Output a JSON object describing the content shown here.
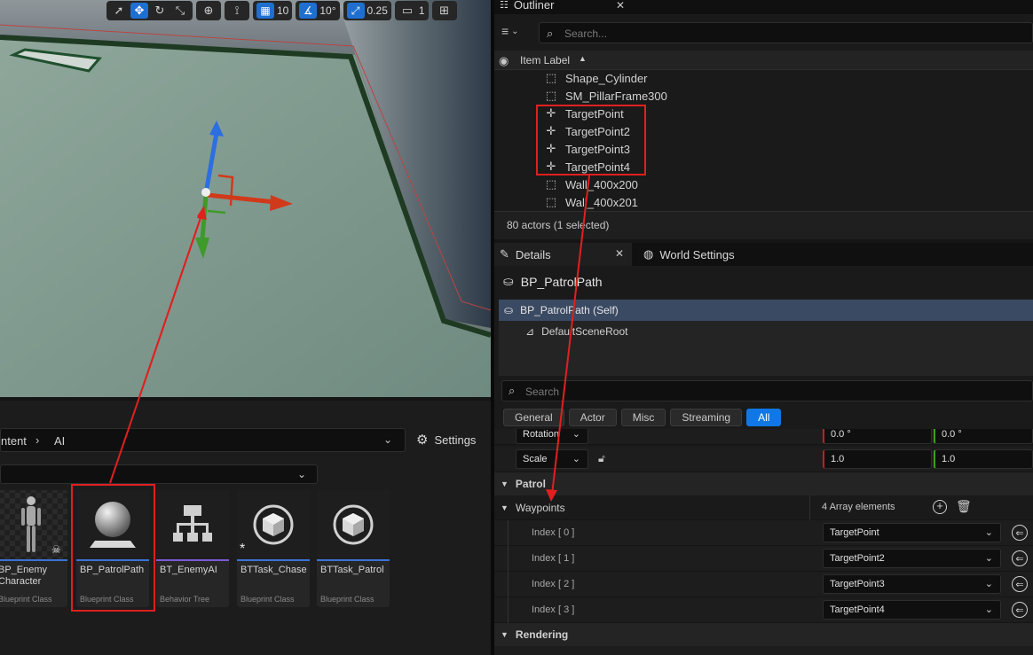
{
  "viewport": {
    "grid_size": "10",
    "rotation_snap": "10°",
    "scale_snap": "0.25",
    "camera_speed": "1"
  },
  "outliner": {
    "tab_label": "Outliner",
    "search_placeholder": "Search...",
    "column_header": "Item Label",
    "items": [
      {
        "label": "Shape_Cylinder",
        "icon": "mesh-icon"
      },
      {
        "label": "SM_PillarFrame300",
        "icon": "mesh-icon"
      },
      {
        "label": "TargetPoint",
        "icon": "target-point-icon"
      },
      {
        "label": "TargetPoint2",
        "icon": "target-point-icon"
      },
      {
        "label": "TargetPoint3",
        "icon": "target-point-icon"
      },
      {
        "label": "TargetPoint4",
        "icon": "target-point-icon"
      },
      {
        "label": "Wall_400x200",
        "icon": "mesh-icon"
      },
      {
        "label": "Wall_400x201",
        "icon": "mesh-icon"
      }
    ],
    "status": "80 actors (1 selected)"
  },
  "details": {
    "tab_label": "Details",
    "world_settings_tab": "World Settings",
    "actor_name": "BP_PatrolPath",
    "components": [
      {
        "label": "BP_PatrolPath (Self)"
      },
      {
        "label": "DefaultSceneRoot"
      }
    ],
    "search_placeholder": "Search",
    "filters": [
      "General",
      "Actor",
      "Misc",
      "Streaming",
      "All"
    ],
    "rotation_label": "Rotation",
    "rotation_x": "0.0 °",
    "rotation_y": "0.0 °",
    "scale_label": "Scale",
    "scale_x": "1.0",
    "scale_y": "1.0",
    "patrol_section": "Patrol",
    "waypoints_label": "Waypoints",
    "waypoints_count": "4 Array elements",
    "waypoints": [
      {
        "index": "Index [ 0 ]",
        "value": "TargetPoint"
      },
      {
        "index": "Index [ 1 ]",
        "value": "TargetPoint2"
      },
      {
        "index": "Index [ 2 ]",
        "value": "TargetPoint3"
      },
      {
        "index": "Index [ 3 ]",
        "value": "TargetPoint4"
      }
    ],
    "rendering_section": "Rendering"
  },
  "content_browser": {
    "path_root": "ntent",
    "path_leaf": "AI",
    "settings_label": "Settings",
    "assets": [
      {
        "name": "BP_Enemy Character",
        "type": "Blueprint Class",
        "accent": "#3b73d6"
      },
      {
        "name": "BP_PatrolPath",
        "type": "Blueprint Class",
        "accent": "#3b73d6"
      },
      {
        "name": "BT_EnemyAI",
        "type": "Behavior Tree",
        "accent": "#7a5ad6"
      },
      {
        "name": "BTTask_Chase",
        "type": "Blueprint Class",
        "accent": "#3b73d6"
      },
      {
        "name": "BTTask_Patrol",
        "type": "Blueprint Class",
        "accent": "#3b73d6"
      }
    ]
  },
  "colors": {
    "accent_blue": "#0f78e6",
    "annotation_red": "#e02020",
    "selection_row": "#3a4a63"
  }
}
